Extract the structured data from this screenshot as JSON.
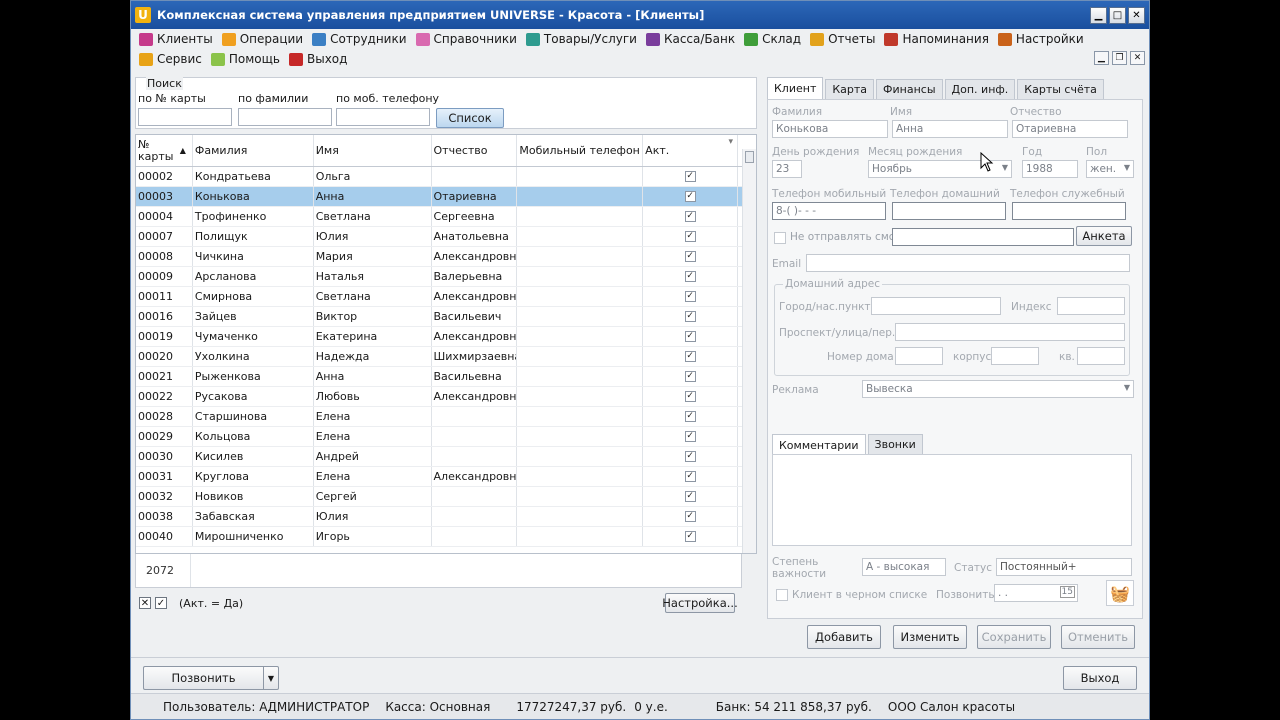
{
  "window": {
    "title": "Комплексная система управления предприятием UNIVERSE - Красота - [Клиенты]",
    "logo_letter": "U"
  },
  "menu": {
    "row1": [
      {
        "label": "Клиенты",
        "icon": "clients-icon",
        "color": "#c53a8a"
      },
      {
        "label": "Операции",
        "icon": "operations-icon",
        "color": "#f0a020"
      },
      {
        "label": "Сотрудники",
        "icon": "employees-icon",
        "color": "#3b7fc4"
      },
      {
        "label": "Справочники",
        "icon": "directories-icon",
        "color": "#d96ab0"
      },
      {
        "label": "Товары/Услуги",
        "icon": "goods-icon",
        "color": "#2e9b8f"
      },
      {
        "label": "Касса/Банк",
        "icon": "cash-icon",
        "color": "#7a3d9c"
      },
      {
        "label": "Склад",
        "icon": "warehouse-icon",
        "color": "#3f9e3a"
      },
      {
        "label": "Отчеты",
        "icon": "reports-icon",
        "color": "#e2a21c"
      },
      {
        "label": "Напоминания",
        "icon": "reminders-icon",
        "color": "#c0392b"
      },
      {
        "label": "Настройки",
        "icon": "settings-icon",
        "color": "#c9621a"
      }
    ],
    "row2": [
      {
        "label": "Сервис",
        "icon": "service-icon",
        "color": "#e8a317"
      },
      {
        "label": "Помощь",
        "icon": "help-icon",
        "color": "#8bc34a"
      },
      {
        "label": "Выход",
        "icon": "exit-icon",
        "color": "#c62828"
      }
    ]
  },
  "search": {
    "legend": "Поиск",
    "by_card_label": "по № карты",
    "by_lastname_label": "по фамилии",
    "by_phone_label": "по моб. телефону",
    "list_button": "Список"
  },
  "grid": {
    "columns": [
      "№ карты",
      "Фамилия",
      "Имя",
      "Отчество",
      "Мобильный телефон",
      "Акт."
    ],
    "rows": [
      {
        "card": "00002",
        "last": "Кондратьева",
        "first": "Ольга",
        "middle": "",
        "phone": "",
        "active": "✓"
      },
      {
        "card": "00003",
        "last": "Конькова",
        "first": "Анна",
        "middle": "Отариевна",
        "phone": "",
        "active": "✓"
      },
      {
        "card": "00004",
        "last": "Трофиненко",
        "first": "Светлана",
        "middle": "Сергеевна",
        "phone": "",
        "active": "✓"
      },
      {
        "card": "00007",
        "last": "Полищук",
        "first": "Юлия",
        "middle": "Анатольевна",
        "phone": "",
        "active": "✓"
      },
      {
        "card": "00008",
        "last": "Чичкина",
        "first": "Мария",
        "middle": "Александровна",
        "phone": "",
        "active": "✓"
      },
      {
        "card": "00009",
        "last": "Арсланова",
        "first": "Наталья",
        "middle": "Валерьевна",
        "phone": "",
        "active": "✓"
      },
      {
        "card": "00011",
        "last": "Смирнова",
        "first": "Светлана",
        "middle": "Александровна",
        "phone": "",
        "active": "✓"
      },
      {
        "card": "00016",
        "last": "Зайцев",
        "first": "Виктор",
        "middle": "Васильевич",
        "phone": "",
        "active": "✓"
      },
      {
        "card": "00019",
        "last": "Чумаченко",
        "first": "Екатерина",
        "middle": "Александровна",
        "phone": "",
        "active": "✓"
      },
      {
        "card": "00020",
        "last": "Ухолкина",
        "first": "Надежда",
        "middle": "Шихмирзаевна",
        "phone": "",
        "active": "✓"
      },
      {
        "card": "00021",
        "last": "Рыженкова",
        "first": "Анна",
        "middle": "Васильевна",
        "phone": "",
        "active": "✓"
      },
      {
        "card": "00022",
        "last": "Русакова",
        "first": "Любовь",
        "middle": "Александровна",
        "phone": "",
        "active": "✓"
      },
      {
        "card": "00028",
        "last": "Старшинова",
        "first": "Елена",
        "middle": "",
        "phone": "",
        "active": "✓"
      },
      {
        "card": "00029",
        "last": "Кольцова",
        "first": "Елена",
        "middle": "",
        "phone": "",
        "active": "✓"
      },
      {
        "card": "00030",
        "last": "Кисилев",
        "first": "Андрей",
        "middle": "",
        "phone": "",
        "active": "✓"
      },
      {
        "card": "00031",
        "last": "Круглова",
        "first": "Елена",
        "middle": "Александровна",
        "phone": "",
        "active": "✓"
      },
      {
        "card": "00032",
        "last": "Новиков",
        "first": "Сергей",
        "middle": "",
        "phone": "",
        "active": "✓"
      },
      {
        "card": "00038",
        "last": "Забавская",
        "first": "Юлия",
        "middle": "",
        "phone": "",
        "active": "✓"
      },
      {
        "card": "00040",
        "last": "Мирошниченко",
        "first": "Игорь",
        "middle": "",
        "phone": "",
        "active": "✓"
      }
    ],
    "selected_index": 1,
    "count": "2072",
    "filter_text": "(Акт. = Да)",
    "settings_button": "Настройка..."
  },
  "client_panel": {
    "tabs": [
      "Клиент",
      "Карта",
      "Финансы",
      "Доп. инф.",
      "Карты счёта"
    ],
    "labels": {
      "lastname": "Фамилия",
      "firstname": "Имя",
      "middlename": "Отчество",
      "birth_day": "День рождения",
      "birth_month": "Месяц рождения",
      "year": "Год",
      "gender": "Пол",
      "mobile": "Телефон мобильный",
      "home_phone": "Телефон домашний",
      "work_phone": "Телефон служебный",
      "no_sms": "Не отправлять смс",
      "email": "Email",
      "home_address": "Домашний адрес",
      "city": "Город/нас.пункт",
      "index": "Индекс",
      "street": "Проспект/улица/пер.",
      "house": "Номер дома",
      "building": "корпус",
      "apt": "кв.",
      "ads": "Реклама",
      "importance": "Степень важности",
      "status": "Статус",
      "blacklist": "Клиент в черном списке",
      "call": "Позвонить"
    },
    "values": {
      "lastname": "Конькова",
      "firstname": "Анна",
      "middlename": "Отариевна",
      "birth_day": "23",
      "birth_month": "Ноябрь",
      "year": "1988",
      "gender": "жен.",
      "mobile": "8-(  )-  -  -",
      "ads": "Вывеска",
      "importance": "А - высокая",
      "status": "Постоянный+",
      "call_value": ". ."
    },
    "anketa_button": "Анкета",
    "sub_tabs": [
      "Комментарии",
      "Звонки"
    ]
  },
  "actions": {
    "add": "Добавить",
    "edit": "Изменить",
    "save": "Сохранить",
    "cancel": "Отменить",
    "call": "Позвонить",
    "exit": "Выход"
  },
  "status": {
    "user": "Пользователь: АДМИНИСТРАТОР",
    "cash": "Касса: Основная",
    "cash_sum": "17727247,37 руб.",
    "cu": "0 у.е.",
    "bank": "Банк: 54 211 858,37 руб.",
    "org": "ООО Салон красоты"
  }
}
